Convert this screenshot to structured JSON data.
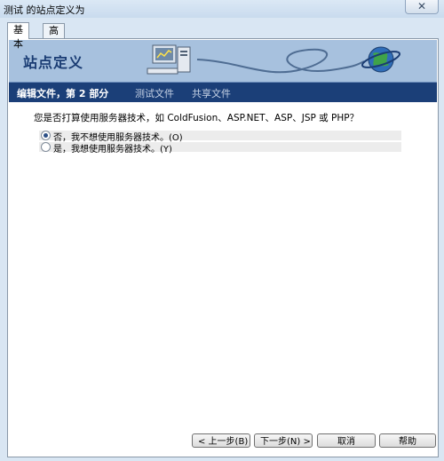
{
  "window": {
    "title": "测试 的站点定义为",
    "close_symbol": "✕"
  },
  "tabs": [
    {
      "label": "基本"
    },
    {
      "label": "高级"
    }
  ],
  "banner": {
    "title": "站点定义"
  },
  "steps": [
    {
      "label": "编辑文件，第 2 部分",
      "current": true
    },
    {
      "label": "测试文件",
      "current": false
    },
    {
      "label": "共享文件",
      "current": false
    }
  ],
  "question": "您是否打算使用服务器技术，如 ColdFusion、ASP.NET、ASP、JSP 或 PHP？",
  "options": [
    {
      "label": "否，我不想使用服务器技术。(O)",
      "selected": true
    },
    {
      "label": "是，我想使用服务器技术。(Y)",
      "selected": false
    }
  ],
  "buttons": {
    "back": "< 上一步(B)",
    "next": "下一步(N) >",
    "cancel": "取消",
    "help": "帮助"
  },
  "colors": {
    "banner": "#a7c1de",
    "navbar": "#1b3f78",
    "accent": "#1a3c73"
  }
}
